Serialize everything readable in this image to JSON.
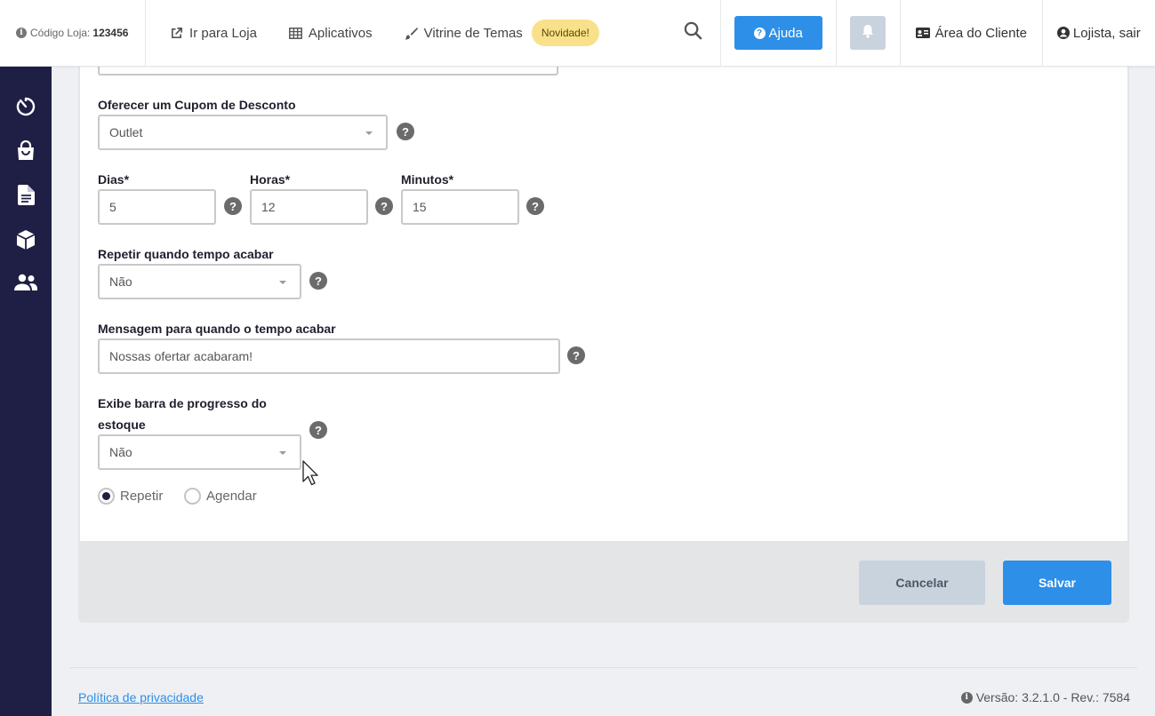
{
  "header": {
    "store_code_label": "Código Loja:",
    "store_code_value": "123456",
    "links": [
      {
        "label": "Ir para Loja",
        "icon": "external-link-icon"
      },
      {
        "label": "Aplicativos",
        "icon": "grid-icon"
      },
      {
        "label": "Vitrine de Temas",
        "icon": "brush-icon"
      }
    ],
    "new_badge": "Novidade!",
    "help_label": "Ajuda",
    "client_area_label": "Área do Cliente",
    "logout_label": "Lojista, sair"
  },
  "sidebar": {
    "icons": [
      "timer-icon",
      "shopping-bag-icon",
      "document-icon",
      "box-icon",
      "users-icon"
    ]
  },
  "form": {
    "coupon": {
      "label": "Oferecer um Cupom de Desconto",
      "value": "Outlet"
    },
    "days": {
      "label": "Dias*",
      "value": "5"
    },
    "hours": {
      "label": "Horas*",
      "value": "12"
    },
    "minutes": {
      "label": "Minutos*",
      "value": "15"
    },
    "repeat": {
      "label": "Repetir quando tempo acabar",
      "value": "Não"
    },
    "message": {
      "label": "Mensagem para quando o tempo acabar",
      "value": "Nossas ofertar acabaram!"
    },
    "progress": {
      "label_line1": "Exibe barra de progresso do",
      "label_line2": "estoque",
      "value": "Não"
    },
    "radio_repeat": "Repetir",
    "radio_schedule": "Agendar",
    "selected_radio": "Repetir"
  },
  "actions": {
    "cancel": "Cancelar",
    "save": "Salvar"
  },
  "footer": {
    "privacy": "Política de privacidade",
    "version": "Versão: 3.2.1.0 - Rev.: 7584"
  },
  "colors": {
    "sidebar_bg": "#1f1f45",
    "primary": "#2d8fe8",
    "badge": "#f9e08a",
    "secondary_button": "#c8d3dd"
  }
}
